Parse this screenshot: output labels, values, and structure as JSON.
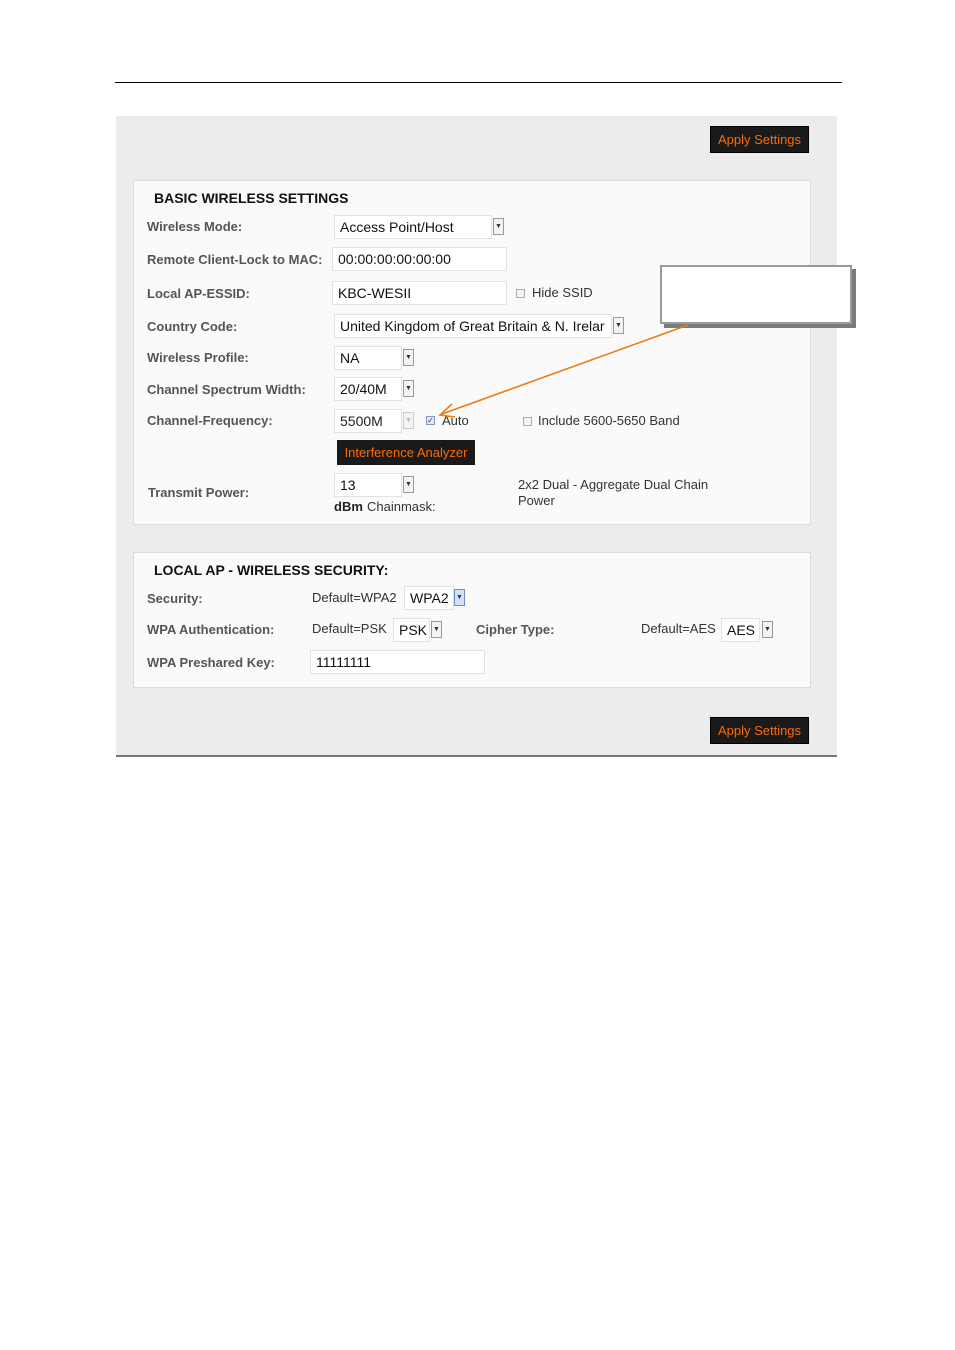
{
  "apply_label": "Apply Settings",
  "basic": {
    "title": "BASIC WIRELESS SETTINGS",
    "wireless_mode": {
      "label": "Wireless Mode:",
      "value": "Access Point/Host"
    },
    "remote_lock": {
      "label": "Remote Client-Lock to MAC:",
      "value": "00:00:00:00:00:00"
    },
    "essid": {
      "label": "Local AP-ESSID:",
      "value": "KBC-WESII",
      "hide_label": "Hide SSID"
    },
    "country": {
      "label": "Country Code:",
      "value": "United Kingdom of Great Britain & N. Irelar"
    },
    "profile": {
      "label": "Wireless Profile:",
      "value": "NA"
    },
    "width": {
      "label": "Channel Spectrum Width:",
      "value": "20/40M"
    },
    "frequency": {
      "label": "Channel-Frequency:",
      "value": "5500M",
      "auto_label": "Auto",
      "band_label": "Include 5600-5650 Band"
    },
    "interference_label": "Interference Analyzer",
    "power": {
      "label": "Transmit Power:",
      "value": "13",
      "unit": "dBm",
      "chainmask_label": "Chainmask:",
      "chain_text": "2x2 Dual - Aggregate Dual Chain Power"
    }
  },
  "security": {
    "title": "LOCAL AP - WIRELESS SECURITY:",
    "security": {
      "label": "Security:",
      "default": "Default=WPA2",
      "value": "WPA2"
    },
    "auth": {
      "label": "WPA Authentication:",
      "default": "Default=PSK",
      "value": "PSK"
    },
    "cipher": {
      "label": "Cipher Type:",
      "default": "Default=AES",
      "value": "AES"
    },
    "key": {
      "label": "WPA Preshared Key:",
      "value": "11111111"
    }
  },
  "colors": {
    "accent": "#ff6a00",
    "arrow": "#f07a10",
    "button_bg": "#1a1a1a"
  }
}
